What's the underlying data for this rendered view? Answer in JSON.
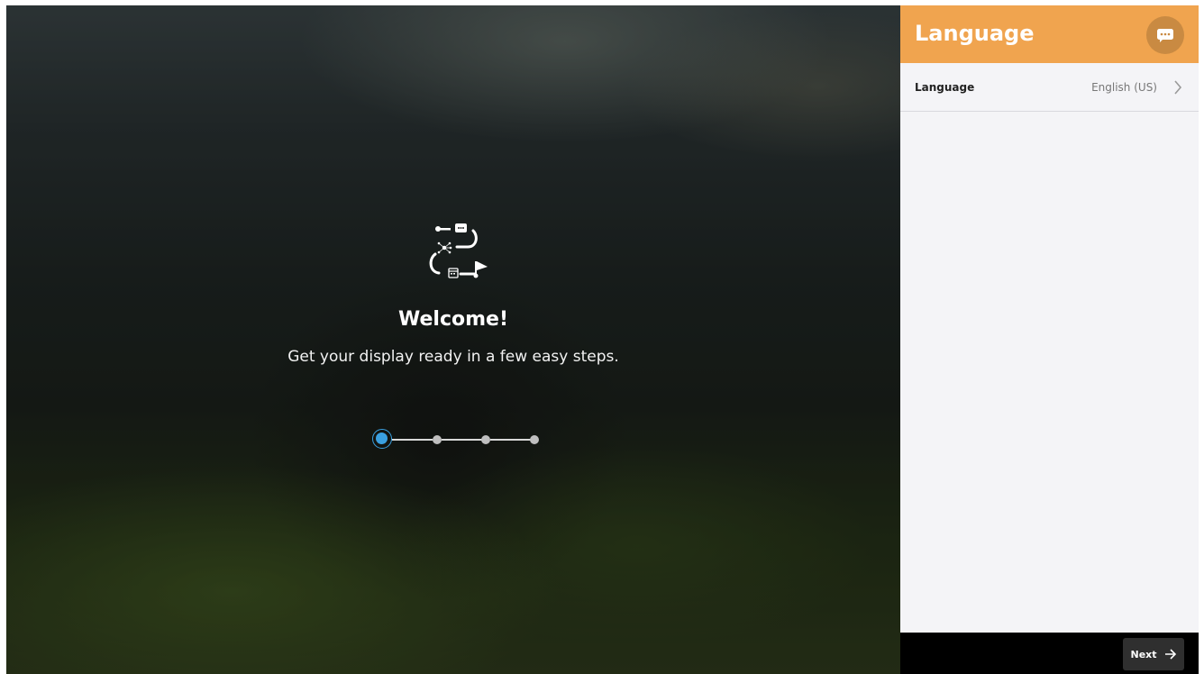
{
  "welcome": {
    "title": "Welcome!",
    "subtitle": "Get your display ready in a few easy steps.",
    "icon": "setup-journey-icon"
  },
  "stepper": {
    "total_steps": 4,
    "current_step": 1,
    "active_color": "#3aa0e0"
  },
  "panel": {
    "title": "Language",
    "header_color": "#f0a44f",
    "chat_icon": "chat-icon",
    "row": {
      "label": "Language",
      "value": "English (US)",
      "icon": "chevron-right-icon"
    }
  },
  "footer": {
    "next_label": "Next",
    "next_icon": "arrow-right-icon"
  }
}
